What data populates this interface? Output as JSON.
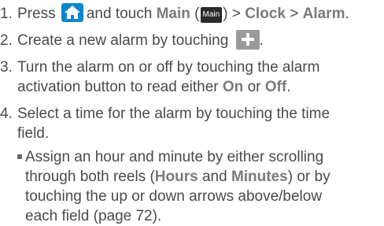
{
  "steps": [
    {
      "number": "1.",
      "text_a": "Press",
      "text_b": "and touch",
      "main": "Main",
      "paren_open": "(",
      "main_icon_label": "Main",
      "paren_close": ")",
      "sep1": ">",
      "clock": "Clock",
      "sep2": ">",
      "alarm": "Alarm",
      "end": "."
    },
    {
      "number": "2.",
      "text": "Create a new alarm by touching",
      "end": "."
    },
    {
      "number": "3.",
      "line1": "Turn the alarm on or off by touching the alarm",
      "line2_a": "activation button to read either",
      "on": "On",
      "or": "or",
      "off": "Off",
      "end": "."
    },
    {
      "number": "4.",
      "line1": "Select a time for the alarm by touching the time",
      "line2": "field."
    }
  ],
  "bullet": {
    "line1": "Assign an hour and minute by either scrolling",
    "line2_a": "through both reels (",
    "hours": "Hours",
    "and": "and",
    "minutes": "Minutes",
    "line2_b": ") or by",
    "line3": "touching the up or down arrows above/below",
    "line4": "each field (page 72)."
  },
  "icons": {
    "home": "home-icon",
    "main": "main-apps-icon",
    "plus": "plus-icon"
  }
}
